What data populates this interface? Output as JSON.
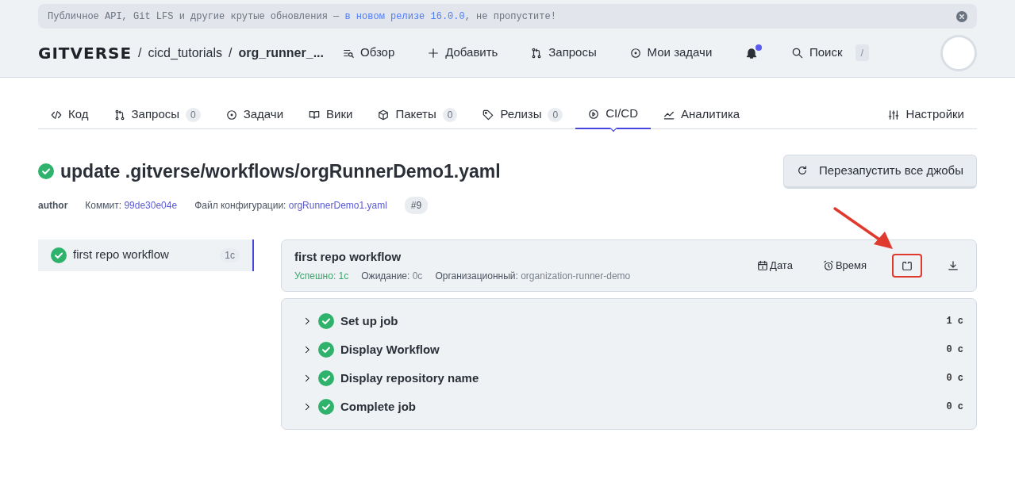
{
  "banner": {
    "text_before": "Публичное API, Git LFS и другие крутые обновления — ",
    "link": "в новом релизе 16.0.0",
    "text_after": ", не пропустите!"
  },
  "header": {
    "logo": "GITVERSE",
    "breadcrumbs": [
      {
        "separator": "/",
        "label": "cicd_tutorials"
      },
      {
        "separator": "/",
        "label": "org_runner_..."
      }
    ],
    "nav": [
      {
        "label": "Обзор"
      },
      {
        "label": "Добавить"
      },
      {
        "label": "Запросы"
      },
      {
        "label": "Мои задачи"
      }
    ],
    "notification_unread": true,
    "search": {
      "label": "Поиск",
      "shortcut": "/"
    }
  },
  "tabs": [
    {
      "label": "Код",
      "selected": false
    },
    {
      "label": "Запросы",
      "count": "0",
      "selected": false
    },
    {
      "label": "Задачи",
      "selected": false
    },
    {
      "label": "Вики",
      "selected": false
    },
    {
      "label": "Пакеты",
      "count": "0",
      "selected": false
    },
    {
      "label": "Релизы",
      "count": "0",
      "selected": false
    },
    {
      "label": "CI/CD",
      "selected": true
    },
    {
      "label": "Аналитика",
      "selected": false
    },
    {
      "label": "Настройки",
      "selected": false
    }
  ],
  "run": {
    "title": "update .gitverse/workflows/orgRunnerDemo1.yaml",
    "author": "author",
    "commit_label": "Коммит:",
    "commit": "99de30e04e",
    "config_label": "Файл конфигурации:",
    "config": "orgRunnerDemo1.yaml",
    "number": "#9",
    "rerun_button": "Перезапустить все джобы"
  },
  "jobs": [
    {
      "name": "first repo workflow",
      "duration": "1с",
      "selected": true
    }
  ],
  "job": {
    "title": "first repo workflow",
    "stats": [
      {
        "label": "Успешно:",
        "value": "1с",
        "kind": "success"
      },
      {
        "label": "Ожидание:",
        "value": "0с",
        "kind": "plain"
      },
      {
        "label": "Организационный:",
        "value": "organization-runner-demo",
        "kind": "plain"
      }
    ],
    "actions": [
      {
        "label": "Дата",
        "kind": "date",
        "highlighted": false
      },
      {
        "label": "Время",
        "kind": "time",
        "highlighted": false
      },
      {
        "kind": "fullscreen",
        "highlighted": true
      },
      {
        "kind": "download",
        "highlighted": false
      }
    ]
  },
  "steps": [
    {
      "name": "Set up job",
      "duration": "1 с",
      "expanded": false
    },
    {
      "name": "Display Workflow",
      "duration": "0 с",
      "expanded": false
    },
    {
      "name": "Display repository name",
      "duration": "0 с",
      "expanded": false
    },
    {
      "name": "Complete job",
      "duration": "0 с",
      "expanded": false
    }
  ]
}
